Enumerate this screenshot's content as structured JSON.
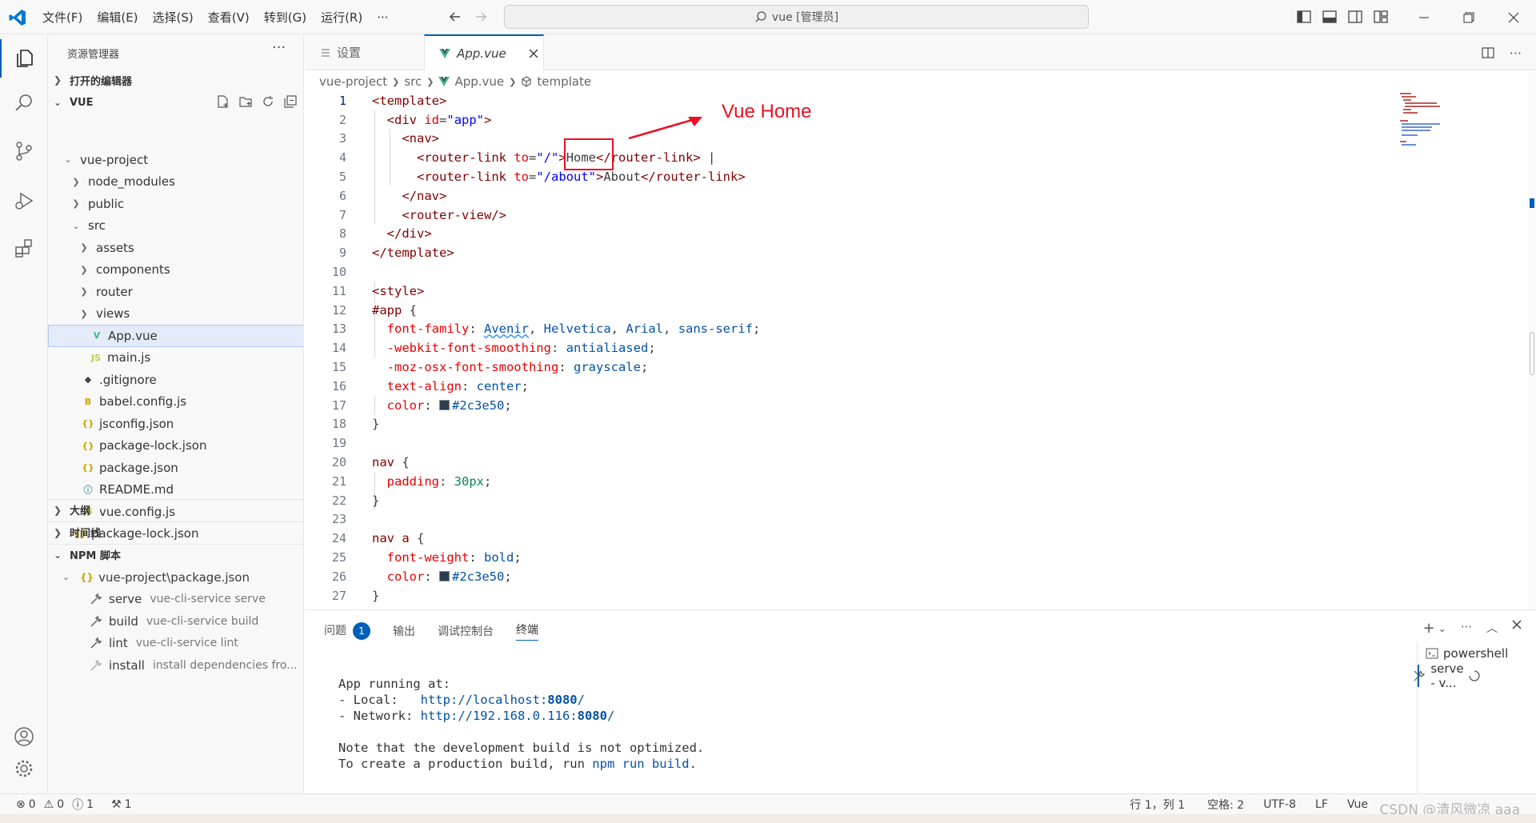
{
  "titlebar": {
    "menu": [
      "文件(F)",
      "编辑(E)",
      "选择(S)",
      "查看(V)",
      "转到(G)",
      "运行(R)",
      "···"
    ],
    "search_text": "vue [管理员]"
  },
  "sidebar": {
    "title": "资源管理器",
    "open_editors": "打开的编辑器",
    "root": "VUE",
    "tree": [
      {
        "label": "vue-project",
        "indent": 1,
        "kind": "folder-open"
      },
      {
        "label": "node_modules",
        "indent": 2,
        "kind": "folder"
      },
      {
        "label": "public",
        "indent": 2,
        "kind": "folder"
      },
      {
        "label": "src",
        "indent": 2,
        "kind": "folder-open"
      },
      {
        "label": "assets",
        "indent": 3,
        "kind": "folder"
      },
      {
        "label": "components",
        "indent": 3,
        "kind": "folder"
      },
      {
        "label": "router",
        "indent": 3,
        "kind": "folder"
      },
      {
        "label": "views",
        "indent": 3,
        "kind": "folder"
      },
      {
        "label": "App.vue",
        "indent": 3,
        "kind": "vue",
        "selected": true
      },
      {
        "label": "main.js",
        "indent": 3,
        "kind": "js"
      },
      {
        "label": ".gitignore",
        "indent": 2,
        "kind": "git"
      },
      {
        "label": "babel.config.js",
        "indent": 2,
        "kind": "babel"
      },
      {
        "label": "jsconfig.json",
        "indent": 2,
        "kind": "json"
      },
      {
        "label": "package-lock.json",
        "indent": 2,
        "kind": "json"
      },
      {
        "label": "package.json",
        "indent": 2,
        "kind": "json"
      },
      {
        "label": "README.md",
        "indent": 2,
        "kind": "info"
      },
      {
        "label": "vue.config.js",
        "indent": 2,
        "kind": "js"
      },
      {
        "label": "package-lock.json",
        "indent": 1,
        "kind": "json"
      }
    ],
    "outline": "大纲",
    "timeline": "时间线",
    "npm": "NPM 脚本",
    "npm_package": "vue-project\\package.json",
    "scripts": [
      {
        "name": "serve",
        "cmd": "vue-cli-service serve"
      },
      {
        "name": "build",
        "cmd": "vue-cli-service build"
      },
      {
        "name": "lint",
        "cmd": "vue-cli-service lint"
      },
      {
        "name": "install",
        "cmd": "install dependencies fro..."
      }
    ]
  },
  "tabs": {
    "settings": "设置",
    "app": "App.vue"
  },
  "breadcrumb": [
    "vue-project",
    "src",
    "App.vue",
    "template"
  ],
  "annotation": "Vue Home",
  "panel": {
    "tabs": [
      "问题",
      "输出",
      "调试控制台",
      "终端"
    ],
    "problem_count": "1",
    "terminal": {
      "l1": "App running at:",
      "l2_pre": "- Local:   ",
      "l2_url_a": "http://localhost:",
      "l2_port": "8080",
      "l2_url_b": "/",
      "l3_pre": "- Network: ",
      "l3_url_a": "http://192.168.0.116:",
      "l3_port": "8080",
      "l3_url_b": "/",
      "l4": "Note that the development build is not optimized.",
      "l5_pre": "To create a production build, run ",
      "l5_cmd": "npm run build",
      "l5_post": "."
    },
    "terminals": [
      "powershell",
      "serve - v..."
    ]
  },
  "status": {
    "errors": "0",
    "warnings": "0",
    "infos": "1",
    "tools": "1",
    "position": "行 1，列 1",
    "spaces": "空格: 2",
    "encoding": "UTF-8",
    "eol": "LF",
    "lang": "Vue"
  },
  "watermark": "CSDN @清风微凉 aaa",
  "colors": {
    "accent": "#005fb8",
    "annotation": "#e81123",
    "swatch": "#2c3e50"
  }
}
